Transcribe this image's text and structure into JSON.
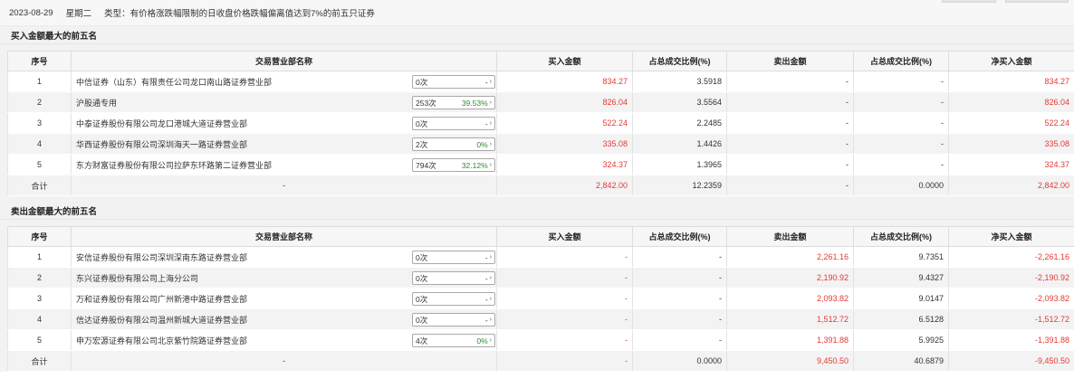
{
  "header": {
    "date": "2023-08-29",
    "weekday": "星期二",
    "type_text": "类型：有价格涨跌幅限制的日收盘价格跌幅偏离值达到7%的前五只证券"
  },
  "columns": [
    "序号",
    "交易营业部名称",
    "买入金额",
    "占总成交比例(%)",
    "卖出金额",
    "占总成交比例(%)",
    "净买入金额"
  ],
  "buy_section": {
    "title": "买入金额最大的前五名",
    "rows": [
      {
        "idx": "1",
        "name": "中信证券（山东）有限责任公司龙口南山路证券营业部",
        "count": "0次",
        "pct": "-",
        "buy": "834.27",
        "buy_ratio": "3.5918",
        "sell": "-",
        "sell_ratio": "-",
        "net": "834.27"
      },
      {
        "idx": "2",
        "name": "沪股通专用",
        "count": "253次",
        "pct": "39.53%",
        "buy": "826.04",
        "buy_ratio": "3.5564",
        "sell": "-",
        "sell_ratio": "-",
        "net": "826.04"
      },
      {
        "idx": "3",
        "name": "中泰证券股份有限公司龙口港城大道证券营业部",
        "count": "0次",
        "pct": "-",
        "buy": "522.24",
        "buy_ratio": "2.2485",
        "sell": "-",
        "sell_ratio": "-",
        "net": "522.24"
      },
      {
        "idx": "4",
        "name": "华西证券股份有限公司深圳海天一路证券营业部",
        "count": "2次",
        "pct": "0%",
        "buy": "335.08",
        "buy_ratio": "1.4426",
        "sell": "-",
        "sell_ratio": "-",
        "net": "335.08"
      },
      {
        "idx": "5",
        "name": "东方财富证券股份有限公司拉萨东环路第二证券营业部",
        "count": "794次",
        "pct": "32.12%",
        "buy": "324.37",
        "buy_ratio": "1.3965",
        "sell": "-",
        "sell_ratio": "-",
        "net": "324.37"
      }
    ],
    "total": {
      "label": "合计",
      "name": "-",
      "buy": "2,842.00",
      "buy_ratio": "12.2359",
      "sell": "-",
      "sell_ratio": "0.0000",
      "net": "2,842.00"
    }
  },
  "sell_section": {
    "title": "卖出金额最大的前五名",
    "rows": [
      {
        "idx": "1",
        "name": "安信证券股份有限公司深圳深南东路证券营业部",
        "count": "0次",
        "pct": "-",
        "buy": "-",
        "buy_ratio": "-",
        "sell": "2,261.16",
        "sell_ratio": "9.7351",
        "net": "-2,261.16"
      },
      {
        "idx": "2",
        "name": "东兴证券股份有限公司上海分公司",
        "count": "0次",
        "pct": "-",
        "buy": "-",
        "buy_ratio": "-",
        "sell": "2,190.92",
        "sell_ratio": "9.4327",
        "net": "-2,190.92"
      },
      {
        "idx": "3",
        "name": "万和证券股份有限公司广州新港中路证券营业部",
        "count": "0次",
        "pct": "-",
        "buy": "-",
        "buy_ratio": "-",
        "sell": "2,093.82",
        "sell_ratio": "9.0147",
        "net": "-2,093.82"
      },
      {
        "idx": "4",
        "name": "信达证券股份有限公司温州新城大道证券营业部",
        "count": "0次",
        "pct": "-",
        "buy": "-",
        "buy_ratio": "-",
        "sell": "1,512.72",
        "sell_ratio": "6.5128",
        "net": "-1,512.72"
      },
      {
        "idx": "5",
        "name": "申万宏源证券有限公司北京紫竹院路证券营业部",
        "count": "4次",
        "pct": "0%",
        "buy": "-",
        "buy_ratio": "-",
        "sell": "1,391.88",
        "sell_ratio": "5.9925",
        "net": "-1,391.88"
      }
    ],
    "total": {
      "label": "合计",
      "name": "-",
      "buy": "-",
      "buy_ratio": "0.0000",
      "sell": "9,450.50",
      "sell_ratio": "40.6879",
      "net": "-9,450.50"
    }
  },
  "colors": {
    "positive": "#e53935",
    "negative": "#2e8b2e",
    "header_bg": "#f6f6f6",
    "stripe": "#f3f3f3"
  }
}
